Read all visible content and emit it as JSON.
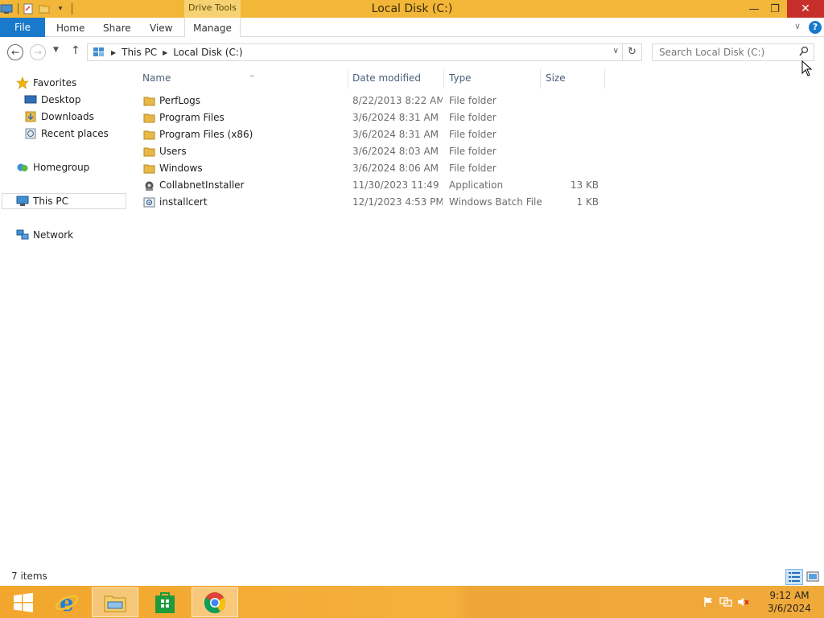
{
  "window": {
    "title": "Local Disk (C:)",
    "contextual_tab_group": "Drive Tools",
    "minimize_glyph": "—",
    "maximize_glyph": "❐",
    "close_glyph": "✕"
  },
  "ribbon": {
    "tabs": [
      "File",
      "Home",
      "Share",
      "View",
      "Manage"
    ],
    "collapse_glyph": "∨",
    "help_glyph": "?"
  },
  "address_bar": {
    "crumbs": [
      "This PC",
      "Local Disk (C:)"
    ],
    "separator_glyph": "▶",
    "dropdown_glyph": "∨",
    "refresh_glyph": "↻",
    "search_placeholder": "Search Local Disk (C:)"
  },
  "nav_pane": {
    "favorites_label": "Favorites",
    "favorites": [
      "Desktop",
      "Downloads",
      "Recent places"
    ],
    "homegroup": "Homegroup",
    "this_pc": "This PC",
    "network": "Network"
  },
  "columns": {
    "name": "Name",
    "date_modified": "Date modified",
    "type": "Type",
    "size": "Size",
    "sort_glyph": "^"
  },
  "files": [
    {
      "name": "PerfLogs",
      "date": "8/22/2013 8:22 AM",
      "type": "File folder",
      "size": "",
      "icon": "folder-icon"
    },
    {
      "name": "Program Files",
      "date": "3/6/2024 8:31 AM",
      "type": "File folder",
      "size": "",
      "icon": "folder-icon"
    },
    {
      "name": "Program Files (x86)",
      "date": "3/6/2024 8:31 AM",
      "type": "File folder",
      "size": "",
      "icon": "folder-icon"
    },
    {
      "name": "Users",
      "date": "3/6/2024 8:03 AM",
      "type": "File folder",
      "size": "",
      "icon": "folder-icon"
    },
    {
      "name": "Windows",
      "date": "3/6/2024 8:06 AM",
      "type": "File folder",
      "size": "",
      "icon": "folder-icon"
    },
    {
      "name": "CollabnetInstaller",
      "date": "11/30/2023 11:49 ...",
      "type": "Application",
      "size": "13 KB",
      "icon": "application-icon"
    },
    {
      "name": "installcert",
      "date": "12/1/2023 4:53 PM",
      "type": "Windows Batch File",
      "size": "1 KB",
      "icon": "batch-file-icon"
    }
  ],
  "status_bar": {
    "item_count": "7 items"
  },
  "taskbar": {
    "time": "9:12 AM",
    "date": "3/6/2024"
  },
  "colors": {
    "accent": "#1979ca",
    "title_bar": "#f2b638",
    "close": "#c7302a",
    "folder": "#e8b84a"
  }
}
